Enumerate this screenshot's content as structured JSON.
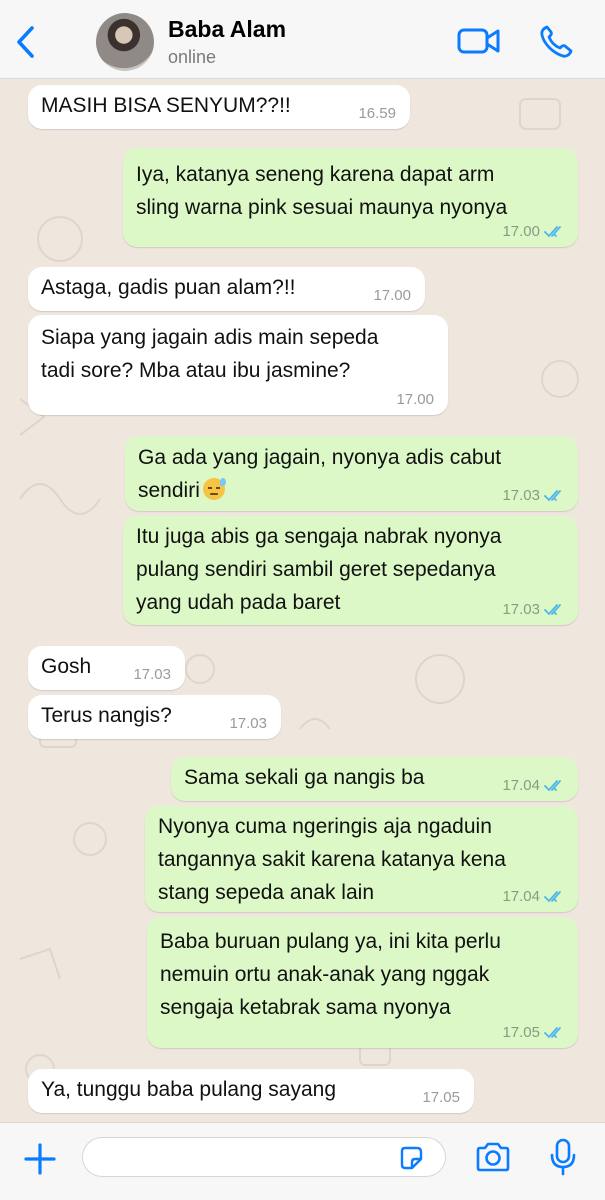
{
  "header": {
    "back_icon": "chevron-left-icon",
    "contact_name": "Baba Alam",
    "status": "online",
    "video_icon": "video-camera-icon",
    "call_icon": "phone-icon"
  },
  "messages": [
    {
      "direction": "in",
      "text": "MASIH BISA SENYUM??!!",
      "time": "16.59"
    },
    {
      "direction": "out",
      "text": "Iya, katanya seneng karena dapat arm\nsling warna pink sesuai maunya nyonya",
      "time": "17.00",
      "read": true
    },
    {
      "direction": "in",
      "text": "Astaga, gadis puan alam?!!",
      "time": "17.00"
    },
    {
      "direction": "in",
      "text": "Siapa yang jagain adis main sepeda\ntadi sore? Mba atau ibu jasmine?",
      "time": "17.00"
    },
    {
      "direction": "out",
      "text": "Ga ada yang jagain, nyonya adis cabut\nsendiri",
      "emoji": "downcast-face-with-sweat",
      "time": "17.03",
      "read": true
    },
    {
      "direction": "out",
      "text": "Itu juga abis ga sengaja nabrak nyonya\npulang sendiri sambil geret sepedanya\nyang udah pada baret",
      "time": "17.03",
      "read": true
    },
    {
      "direction": "in",
      "text": "Gosh",
      "time": "17.03"
    },
    {
      "direction": "in",
      "text": "Terus nangis?",
      "time": "17.03"
    },
    {
      "direction": "out",
      "text": "Sama sekali ga nangis ba",
      "time": "17.04",
      "read": true
    },
    {
      "direction": "out",
      "text": "Nyonya cuma ngeringis aja ngaduin\ntangannya sakit karena katanya kena\nstang sepeda anak lain",
      "time": "17.04",
      "read": true
    },
    {
      "direction": "out",
      "text": "Baba buruan pulang ya, ini kita perlu\nnemuin ortu anak-anak yang nggak\nsengaja ketabrak sama nyonya",
      "time": "17.05",
      "read": true
    },
    {
      "direction": "in",
      "text": "Ya, tunggu baba pulang sayang",
      "time": "17.05"
    }
  ],
  "footer": {
    "plus_icon": "plus-icon",
    "input_value": "",
    "sticker_icon": "sticker-icon",
    "camera_icon": "camera-icon",
    "mic_icon": "microphone-icon"
  },
  "colors": {
    "accent": "#0a7cff",
    "incoming_bubble": "#ffffff",
    "outgoing_bubble": "#dcf8c6",
    "read_ticks": "#4fb6ec",
    "chat_background": "#efe7de"
  }
}
